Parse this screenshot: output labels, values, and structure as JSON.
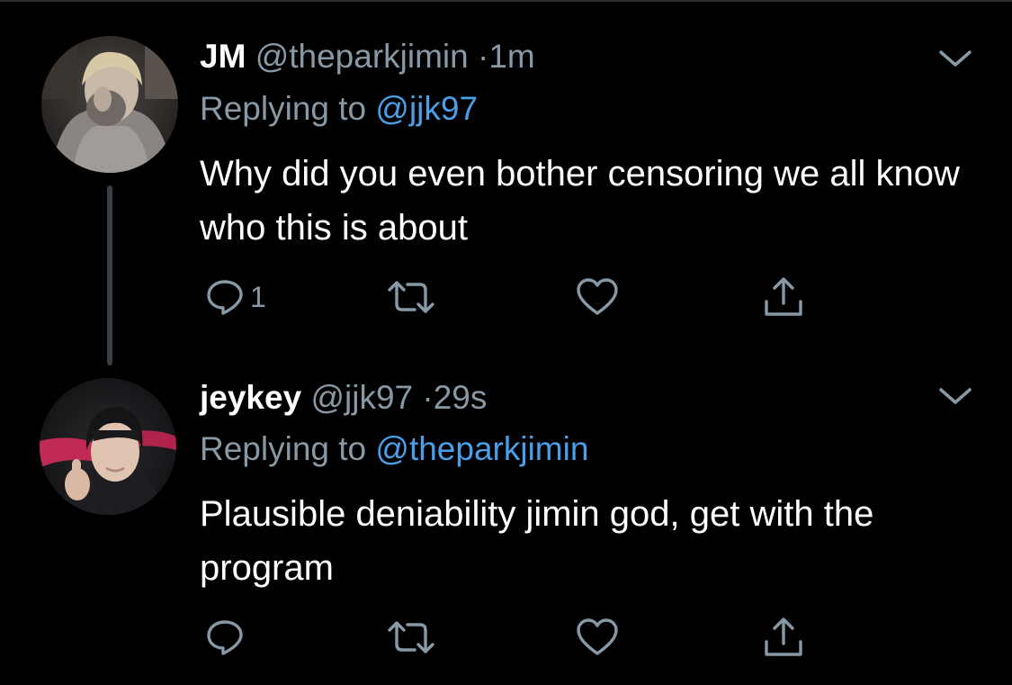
{
  "colors": {
    "background": "#000000",
    "primary_text": "#ffffff",
    "secondary_text": "#8899a6",
    "link": "#4a9fe8",
    "icon": "#8899a6"
  },
  "tweets": [
    {
      "name": "JM",
      "handle": "@theparkjimin",
      "separator": "·",
      "time": "1m",
      "replying_prefix": "Replying to",
      "replying_to": "@jjk97",
      "text": "Why did you even bother censoring we all know who this is about",
      "reply_count": "1",
      "icons": {
        "avatar": "avatar-photo",
        "menu": "chevron-down-icon",
        "reply": "reply-icon",
        "retweet": "retweet-icon",
        "like": "heart-icon",
        "share": "share-icon"
      }
    },
    {
      "name": "jeykey",
      "handle": "@jjk97",
      "separator": "·",
      "time": "29s",
      "replying_prefix": "Replying to",
      "replying_to": "@theparkjimin",
      "text": "Plausible deniability jimin god, get with the program",
      "reply_count": "",
      "icons": {
        "avatar": "avatar-photo",
        "menu": "chevron-down-icon",
        "reply": "reply-icon",
        "retweet": "retweet-icon",
        "like": "heart-icon",
        "share": "share-icon"
      }
    }
  ]
}
